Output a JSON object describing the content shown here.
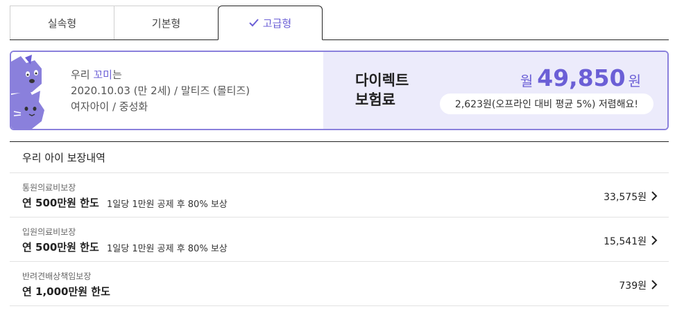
{
  "tabs": [
    {
      "label": "실속형",
      "selected": false
    },
    {
      "label": "기본형",
      "selected": false
    },
    {
      "label": "고급형",
      "selected": true
    }
  ],
  "pet": {
    "prefix": "우리 ",
    "name": "꼬미",
    "suffix": "는",
    "birth_breed": "2020.10.03 (만 2세) / 말티즈 (몰티즈)",
    "gender_status": "여자아이 / 중성화"
  },
  "price": {
    "title_line1": "다이렉트",
    "title_line2": "보험료",
    "prefix": "월",
    "amount": "49,850",
    "unit": "원",
    "savings": "2,623원(오프라인 대비 평균 5%) 저렴해요!"
  },
  "coverage": {
    "heading": "우리 아이 보장내역",
    "items": [
      {
        "category": "통원의료비보장",
        "limit": "연 500만원 한도",
        "desc": "1일당 1만원 공제 후 80% 보상",
        "amount": "33,575원"
      },
      {
        "category": "입원의료비보장",
        "limit": "연 500만원 한도",
        "desc": "1일당 1만원 공제 후 80% 보상",
        "amount": "15,541원"
      },
      {
        "category": "반려견배상책임보장",
        "limit": "연 1,000만원 한도",
        "desc": "",
        "amount": "739원"
      }
    ]
  },
  "colors": {
    "accent": "#6b5fd6",
    "accent_light": "#ecebfb",
    "border_accent": "#8a80dc"
  }
}
